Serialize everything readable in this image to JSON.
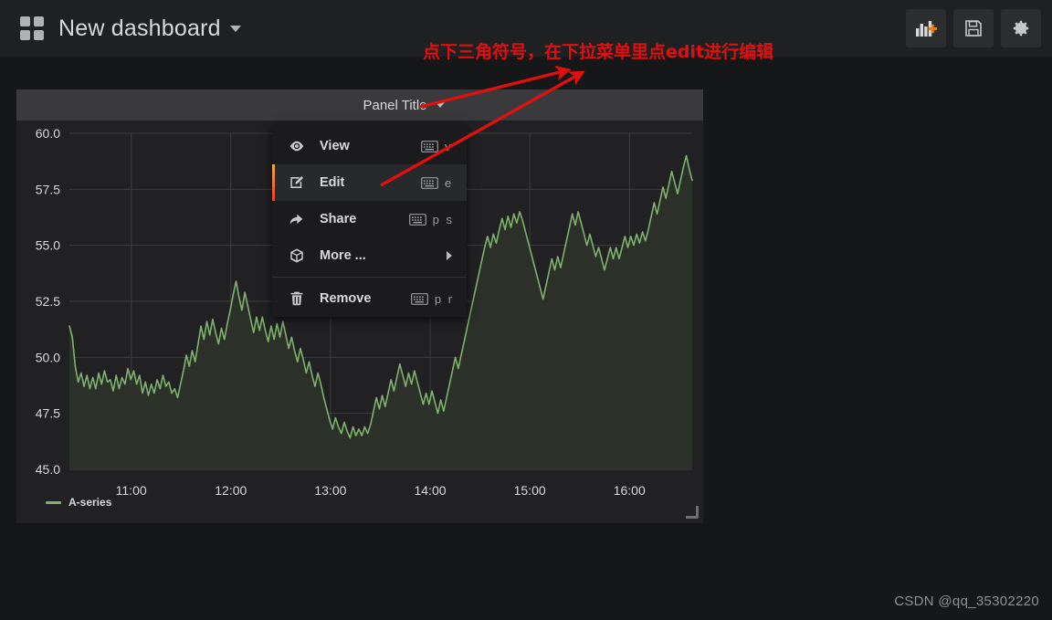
{
  "navbar": {
    "dashboard_icon": "dashboard-grid-icon",
    "title": "New dashboard",
    "caret": "chevron-down-icon",
    "buttons": [
      {
        "name": "add-panel-button",
        "icon": "bar-chart-plus-icon",
        "label": "Add panel"
      },
      {
        "name": "save-dashboard-button",
        "icon": "floppy-disk-icon",
        "label": "Save dashboard"
      },
      {
        "name": "dashboard-settings-button",
        "icon": "gear-icon",
        "label": "Dashboard settings"
      }
    ]
  },
  "panel": {
    "title": "Panel Title",
    "caret": "chevron-down-icon",
    "resize_handle": "resize-handle-icon"
  },
  "context_menu": {
    "items": [
      {
        "label": "View",
        "icon": "eye-icon",
        "shortcut": "v",
        "has_kbd": true,
        "submenu": false,
        "active": false
      },
      {
        "label": "Edit",
        "icon": "pencil-square-icon",
        "shortcut": "e",
        "has_kbd": true,
        "submenu": false,
        "active": true
      },
      {
        "label": "Share",
        "icon": "share-arrow-icon",
        "shortcut": "p s",
        "has_kbd": true,
        "submenu": false,
        "active": false
      },
      {
        "label": "More ...",
        "icon": "cube-icon",
        "shortcut": "",
        "has_kbd": false,
        "submenu": true,
        "active": false
      },
      {
        "label": "Remove",
        "icon": "trash-icon",
        "shortcut": "p r",
        "has_kbd": true,
        "submenu": false,
        "active": false
      }
    ]
  },
  "annotation": {
    "text": "点下三角符号，在下拉菜单里点edit进行编辑",
    "color": "#e10f0f",
    "arrows": 2
  },
  "watermark": {
    "text": "CSDN @qq_35302220"
  },
  "colors": {
    "page_background": "#161719",
    "navbar_background": "#1f2022",
    "panel_background": "#212124",
    "panel_header": "#3a3a3c",
    "series_line": "#7eb26d",
    "series_fill": "#2b3029",
    "grid_line": "#3b3d3c",
    "accent_orange": "#f2a93b",
    "annotation_red": "#e10f0f"
  },
  "chart_data": {
    "type": "area",
    "title": "Panel Title",
    "xlabel": "",
    "ylabel": "",
    "legend": [
      {
        "name": "A-series",
        "color": "#7eb26d"
      }
    ],
    "legend_position": "bottom-left",
    "grid": true,
    "ylim": [
      45.0,
      60.0
    ],
    "yticks": [
      "45.0",
      "47.5",
      "50.0",
      "52.5",
      "55.0",
      "57.5",
      "60.0"
    ],
    "ytick_values": [
      45.0,
      47.5,
      50.0,
      52.5,
      55.0,
      57.5,
      60.0
    ],
    "xticks": [
      "11:00",
      "12:00",
      "13:00",
      "14:00",
      "15:00",
      "16:00"
    ],
    "xlim": [
      "10:38",
      "16:05"
    ],
    "series": [
      {
        "name": "A-series",
        "color": "#7eb26d",
        "values": [
          51.4,
          50.9,
          49.6,
          48.9,
          49.3,
          48.7,
          49.2,
          48.6,
          49.1,
          48.6,
          49.3,
          48.8,
          49.4,
          48.9,
          49.0,
          48.5,
          49.2,
          48.6,
          49.1,
          48.8,
          49.5,
          49.0,
          49.4,
          48.8,
          49.2,
          48.4,
          48.9,
          48.3,
          48.8,
          48.4,
          49.0,
          48.6,
          49.2,
          48.7,
          48.9,
          48.4,
          48.6,
          48.2,
          48.8,
          49.4,
          50.1,
          49.6,
          50.3,
          49.8,
          50.6,
          51.4,
          50.8,
          51.6,
          51.0,
          51.7,
          51.1,
          50.6,
          51.3,
          50.8,
          51.5,
          52.1,
          52.8,
          53.4,
          52.7,
          52.1,
          52.9,
          52.3,
          51.7,
          51.1,
          51.8,
          51.2,
          51.8,
          51.2,
          50.7,
          51.4,
          50.8,
          51.5,
          50.9,
          51.6,
          51.0,
          50.4,
          50.9,
          50.3,
          49.8,
          50.4,
          49.9,
          49.3,
          49.8,
          49.2,
          48.7,
          49.3,
          48.8,
          48.2,
          47.7,
          47.2,
          46.8,
          47.3,
          46.9,
          46.6,
          47.1,
          46.7,
          46.4,
          46.9,
          46.5,
          46.8,
          46.5,
          46.9,
          46.6,
          47.0,
          47.6,
          48.2,
          47.7,
          48.3,
          47.8,
          48.4,
          49.0,
          48.5,
          49.1,
          49.7,
          49.2,
          48.7,
          49.3,
          48.8,
          49.4,
          48.9,
          48.4,
          47.9,
          48.4,
          47.9,
          48.5,
          48.0,
          47.5,
          48.1,
          47.6,
          48.2,
          48.8,
          49.4,
          50.0,
          49.5,
          50.1,
          50.7,
          51.3,
          51.9,
          52.5,
          53.1,
          53.7,
          54.3,
          54.9,
          55.4,
          54.9,
          55.5,
          55.1,
          55.7,
          56.2,
          55.7,
          56.3,
          55.8,
          56.4,
          56.0,
          56.5,
          56.1,
          55.6,
          55.1,
          54.6,
          54.1,
          53.6,
          53.1,
          52.6,
          53.2,
          53.8,
          54.4,
          53.9,
          54.5,
          54.0,
          54.6,
          55.2,
          55.8,
          56.4,
          55.9,
          56.5,
          56.0,
          55.5,
          55.0,
          55.5,
          55.0,
          54.5,
          54.9,
          54.4,
          53.9,
          54.4,
          54.9,
          54.4,
          54.9,
          54.4,
          54.9,
          55.4,
          54.9,
          55.4,
          55.0,
          55.5,
          55.1,
          55.6,
          55.2,
          55.7,
          56.3,
          56.9,
          56.4,
          57.0,
          57.6,
          57.1,
          57.7,
          58.3,
          57.8,
          57.3,
          57.9,
          58.5,
          59.0,
          58.4,
          57.9
        ]
      }
    ]
  }
}
